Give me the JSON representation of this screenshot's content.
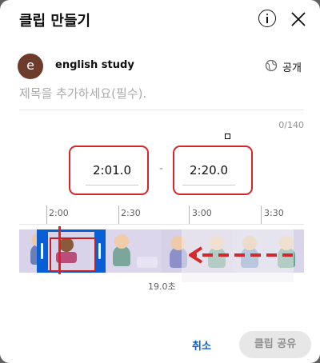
{
  "header": {
    "title": "클립 만들기"
  },
  "channel": {
    "avatar_letter": "e",
    "name": "english study",
    "visibility": "공개"
  },
  "title_input": {
    "placeholder": "제목을 추가하세요(필수).",
    "char_count": "0/140"
  },
  "clip": {
    "start": "2:01.0",
    "end": "2:20.0",
    "duration": "19.0초"
  },
  "timeline": {
    "ticks": [
      "2:00",
      "2:30",
      "3:00",
      "3:30"
    ]
  },
  "actions": {
    "cancel": "취소",
    "share": "클립 공유"
  },
  "colors": {
    "accent": "#065fd4",
    "annotation": "#d62828"
  }
}
